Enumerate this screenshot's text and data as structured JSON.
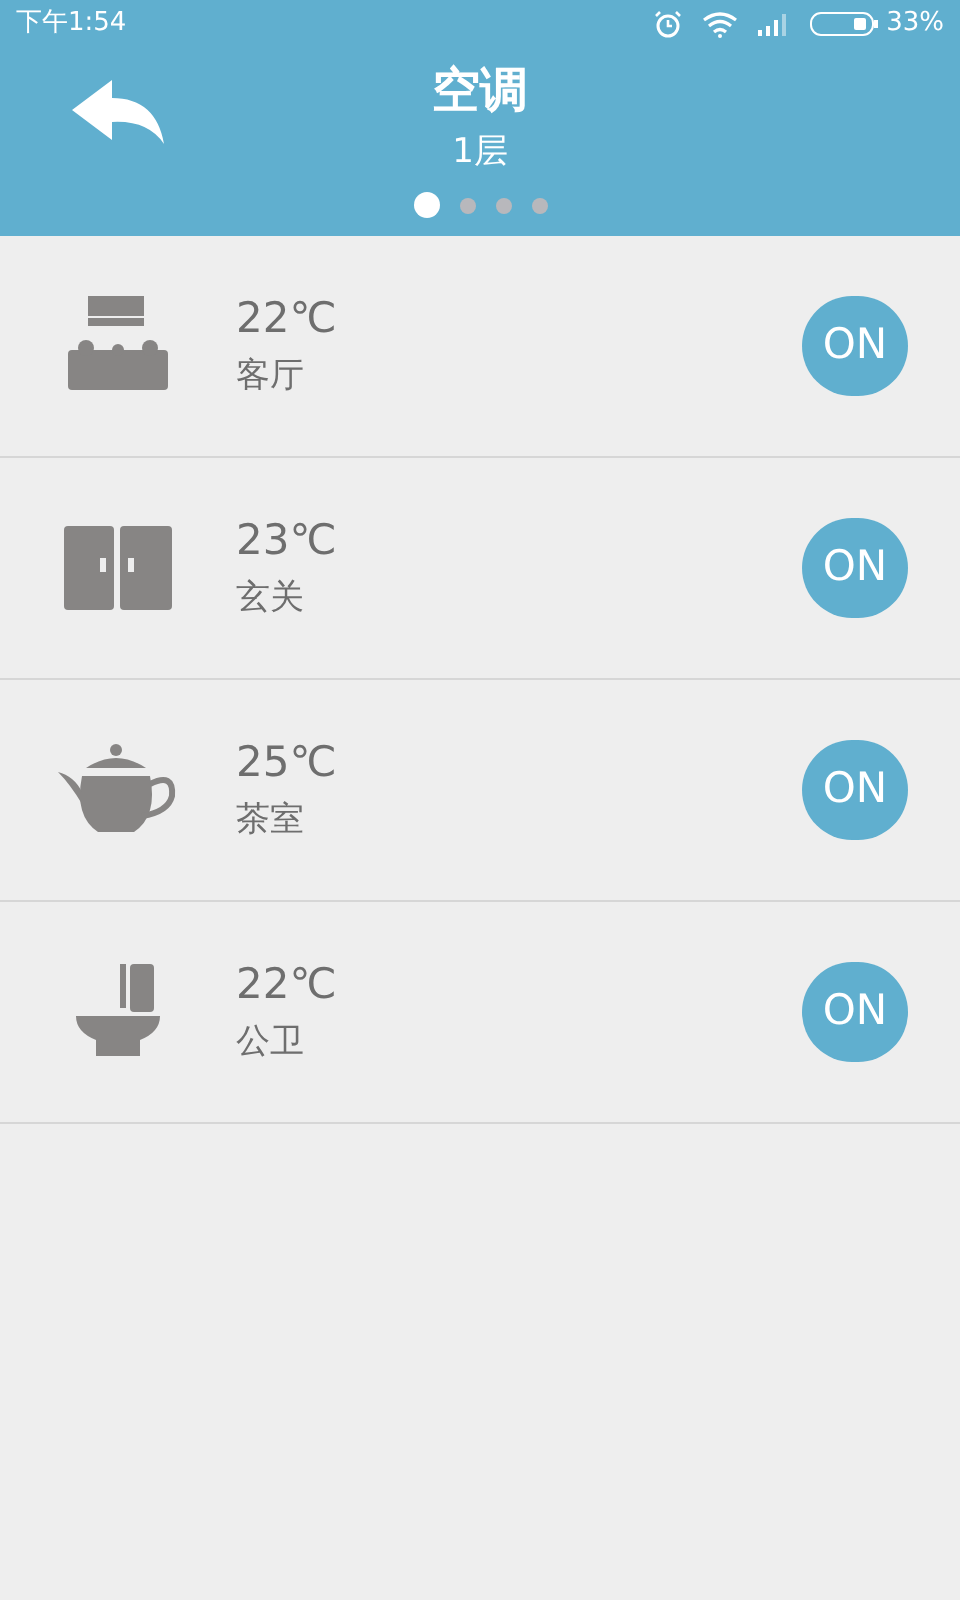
{
  "status_bar": {
    "time": "下午1:54",
    "battery": "33%"
  },
  "header": {
    "title": "空调",
    "subtitle": "1层",
    "pages": [
      {
        "selected": true
      },
      {
        "selected": false
      },
      {
        "selected": false
      },
      {
        "selected": false
      }
    ]
  },
  "rooms": [
    {
      "kind": "living",
      "temperature": "22℃",
      "name": "客厅",
      "switch": "ON",
      "on": true
    },
    {
      "kind": "entrance",
      "temperature": "23℃",
      "name": "玄关",
      "switch": "ON",
      "on": true
    },
    {
      "kind": "tea",
      "temperature": "25℃",
      "name": "茶室",
      "switch": "ON",
      "on": true
    },
    {
      "kind": "toilet",
      "temperature": "22℃",
      "name": "公卫",
      "switch": "ON",
      "on": true
    }
  ]
}
